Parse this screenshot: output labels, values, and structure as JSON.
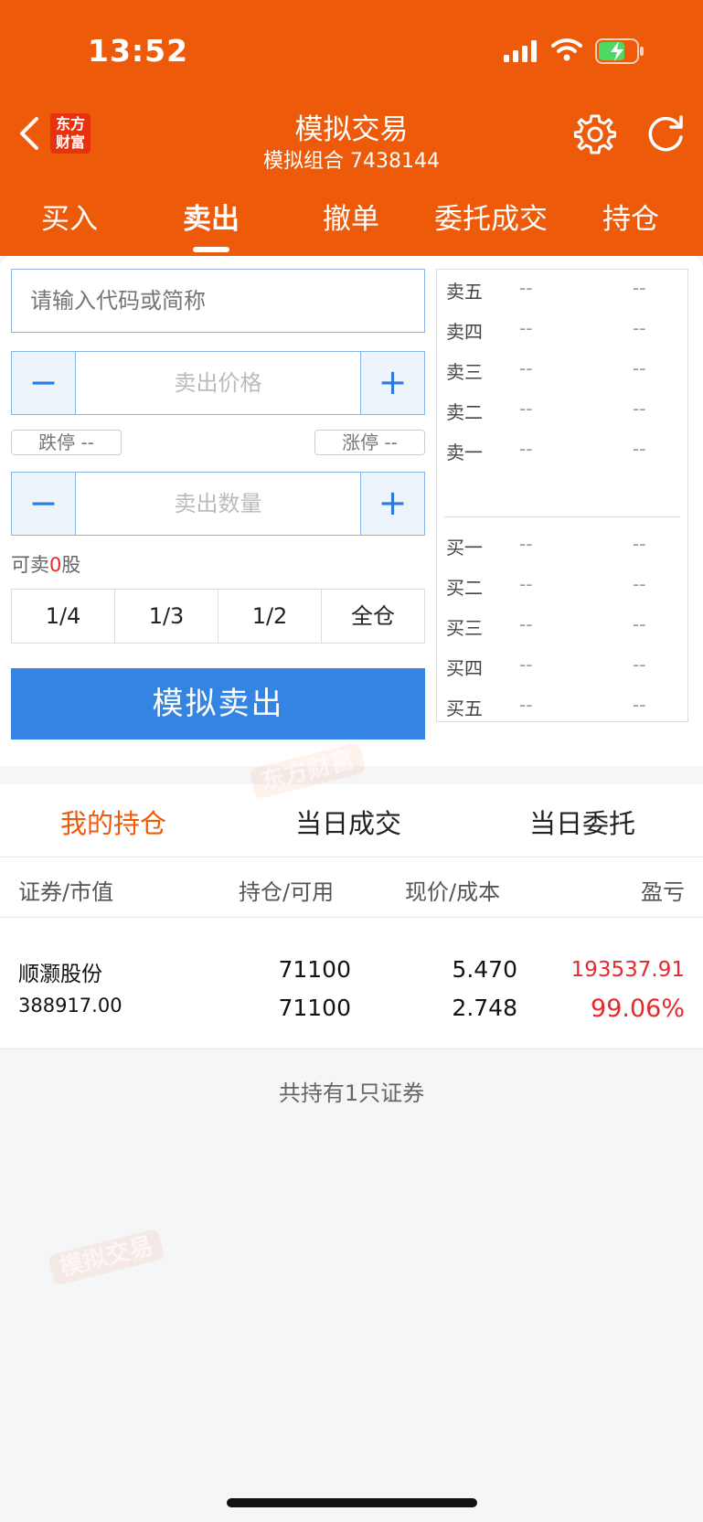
{
  "status": {
    "time": "13:52"
  },
  "header": {
    "logo_line1": "东方",
    "logo_line2": "财富",
    "title": "模拟交易",
    "subtitle": "模拟组合 7438144"
  },
  "tabs": [
    "买入",
    "卖出",
    "撤单",
    "委托成交",
    "持仓"
  ],
  "form": {
    "code_placeholder": "请输入代码或简称",
    "price_placeholder": "卖出价格",
    "qty_placeholder": "卖出数量",
    "limit_down": "跌停 --",
    "limit_up": "涨停 --",
    "avail_prefix": "可卖",
    "avail_count": "0",
    "avail_suffix": "股",
    "ratios": [
      "1/4",
      "1/3",
      "1/2",
      "全仓"
    ],
    "sell_label": "模拟卖出"
  },
  "orderbook": {
    "asks": [
      {
        "label": "卖五",
        "price": "--",
        "vol": "--"
      },
      {
        "label": "卖四",
        "price": "--",
        "vol": "--"
      },
      {
        "label": "卖三",
        "price": "--",
        "vol": "--"
      },
      {
        "label": "卖二",
        "price": "--",
        "vol": "--"
      },
      {
        "label": "卖一",
        "price": "--",
        "vol": "--"
      }
    ],
    "bids": [
      {
        "label": "买一",
        "price": "--",
        "vol": "--"
      },
      {
        "label": "买二",
        "price": "--",
        "vol": "--"
      },
      {
        "label": "买三",
        "price": "--",
        "vol": "--"
      },
      {
        "label": "买四",
        "price": "--",
        "vol": "--"
      },
      {
        "label": "买五",
        "price": "--",
        "vol": "--"
      }
    ]
  },
  "holdings": {
    "tabs": [
      "我的持仓",
      "当日成交",
      "当日委托"
    ],
    "headers": [
      "证券/市值",
      "持仓/可用",
      "现价/成本",
      "盈亏"
    ],
    "rows": [
      {
        "name": "顺灏股份",
        "market_value": "388917.00",
        "position": "71100",
        "available": "71100",
        "price": "5.470",
        "cost": "2.748",
        "pnl": "193537.91",
        "pnl_pct": "99.06%"
      }
    ],
    "summary": "共持有1只证券"
  },
  "watermark": {
    "brand": "东方财富",
    "tag": "模拟交易"
  },
  "colors": {
    "brand_orange": "#ec5a0a",
    "sell_blue": "#3384e3",
    "profit_red": "#e8282b"
  }
}
